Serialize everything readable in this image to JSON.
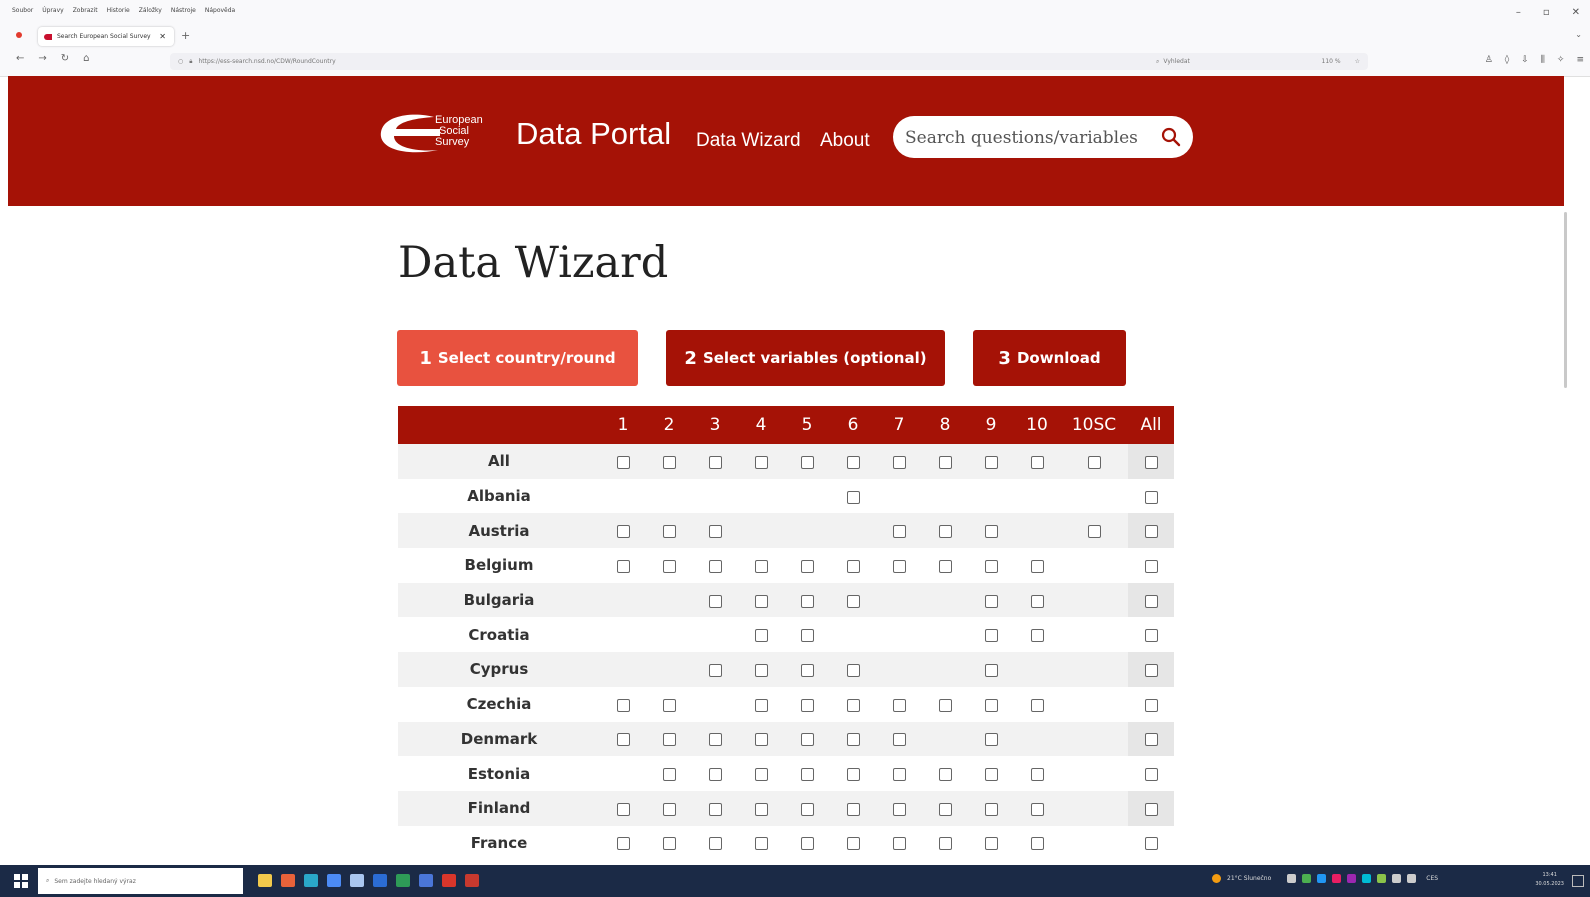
{
  "browser": {
    "menu": [
      "Soubor",
      "Úpravy",
      "Zobrazit",
      "Historie",
      "Záložky",
      "Nástroje",
      "Nápověda"
    ],
    "tab_title": "Search European Social Survey",
    "url": "https://ess-search.nsd.no/CDW/RoundCountry",
    "zoom": "110 %",
    "search_placeholder": "Vyhledat"
  },
  "header": {
    "logo_lines": [
      "European",
      "Social",
      "Survey"
    ],
    "title": "Data Portal",
    "nav": {
      "wizard": "Data Wizard",
      "about": "About"
    },
    "search_placeholder": "Search questions/variables"
  },
  "page_title": "Data Wizard",
  "steps": [
    {
      "num": "1",
      "label": "Select country/round",
      "active": true
    },
    {
      "num": "2",
      "label": "Select variables (optional)",
      "active": false
    },
    {
      "num": "3",
      "label": "Download",
      "active": false
    }
  ],
  "table": {
    "columns": [
      "1",
      "2",
      "3",
      "4",
      "5",
      "6",
      "7",
      "8",
      "9",
      "10",
      "10SC",
      "All"
    ],
    "rows": [
      {
        "country": "All",
        "rounds": [
          1,
          1,
          1,
          1,
          1,
          1,
          1,
          1,
          1,
          1,
          1,
          1
        ]
      },
      {
        "country": "Albania",
        "rounds": [
          0,
          0,
          0,
          0,
          0,
          1,
          0,
          0,
          0,
          0,
          0,
          1
        ]
      },
      {
        "country": "Austria",
        "rounds": [
          1,
          1,
          1,
          0,
          0,
          0,
          1,
          1,
          1,
          0,
          1,
          1
        ]
      },
      {
        "country": "Belgium",
        "rounds": [
          1,
          1,
          1,
          1,
          1,
          1,
          1,
          1,
          1,
          1,
          0,
          1
        ]
      },
      {
        "country": "Bulgaria",
        "rounds": [
          0,
          0,
          1,
          1,
          1,
          1,
          0,
          0,
          1,
          1,
          0,
          1
        ]
      },
      {
        "country": "Croatia",
        "rounds": [
          0,
          0,
          0,
          1,
          1,
          0,
          0,
          0,
          1,
          1,
          0,
          1
        ]
      },
      {
        "country": "Cyprus",
        "rounds": [
          0,
          0,
          1,
          1,
          1,
          1,
          0,
          0,
          1,
          0,
          0,
          1
        ]
      },
      {
        "country": "Czechia",
        "rounds": [
          1,
          1,
          0,
          1,
          1,
          1,
          1,
          1,
          1,
          1,
          0,
          1
        ]
      },
      {
        "country": "Denmark",
        "rounds": [
          1,
          1,
          1,
          1,
          1,
          1,
          1,
          0,
          1,
          0,
          0,
          1
        ]
      },
      {
        "country": "Estonia",
        "rounds": [
          0,
          1,
          1,
          1,
          1,
          1,
          1,
          1,
          1,
          1,
          0,
          1
        ]
      },
      {
        "country": "Finland",
        "rounds": [
          1,
          1,
          1,
          1,
          1,
          1,
          1,
          1,
          1,
          1,
          0,
          1
        ]
      },
      {
        "country": "France",
        "rounds": [
          1,
          1,
          1,
          1,
          1,
          1,
          1,
          1,
          1,
          1,
          0,
          1
        ]
      }
    ]
  },
  "taskbar": {
    "search_placeholder": "Sem zadejte hledaný výraz",
    "weather": "21°C Slunečno",
    "lang": "CES",
    "time": "13:41",
    "date": "30.05.2023"
  },
  "colors": {
    "brand": "#a51206",
    "active_step": "#e8523f"
  }
}
